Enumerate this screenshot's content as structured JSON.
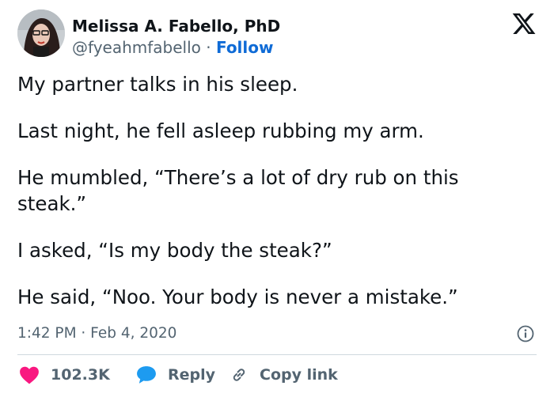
{
  "author": {
    "name": "Melissa A. Fabello, PhD",
    "handle": "@fyeahmfabello",
    "separator": "·",
    "follow_label": "Follow"
  },
  "tweet": {
    "paragraphs": [
      "My partner talks in his sleep.",
      "Last night, he fell asleep rubbing my arm.",
      "He mumbled, “There’s a lot of dry rub on this steak.”",
      "I asked, “Is my body the steak?”",
      "He said, “Noo. Your body is never a mistake.”"
    ],
    "timestamp": "1:42 PM · Feb 4, 2020"
  },
  "actions": {
    "like_count": "102.3K",
    "reply_label": "Reply",
    "copy_label": "Copy link"
  },
  "colors": {
    "like_red": "#f91880",
    "reply_blue": "#1d9bf0",
    "follow_blue": "#0f6bd6",
    "muted": "#536471"
  },
  "icons": [
    "x-logo-icon",
    "info-icon",
    "heart-icon",
    "speech-bubble-icon",
    "link-icon"
  ]
}
